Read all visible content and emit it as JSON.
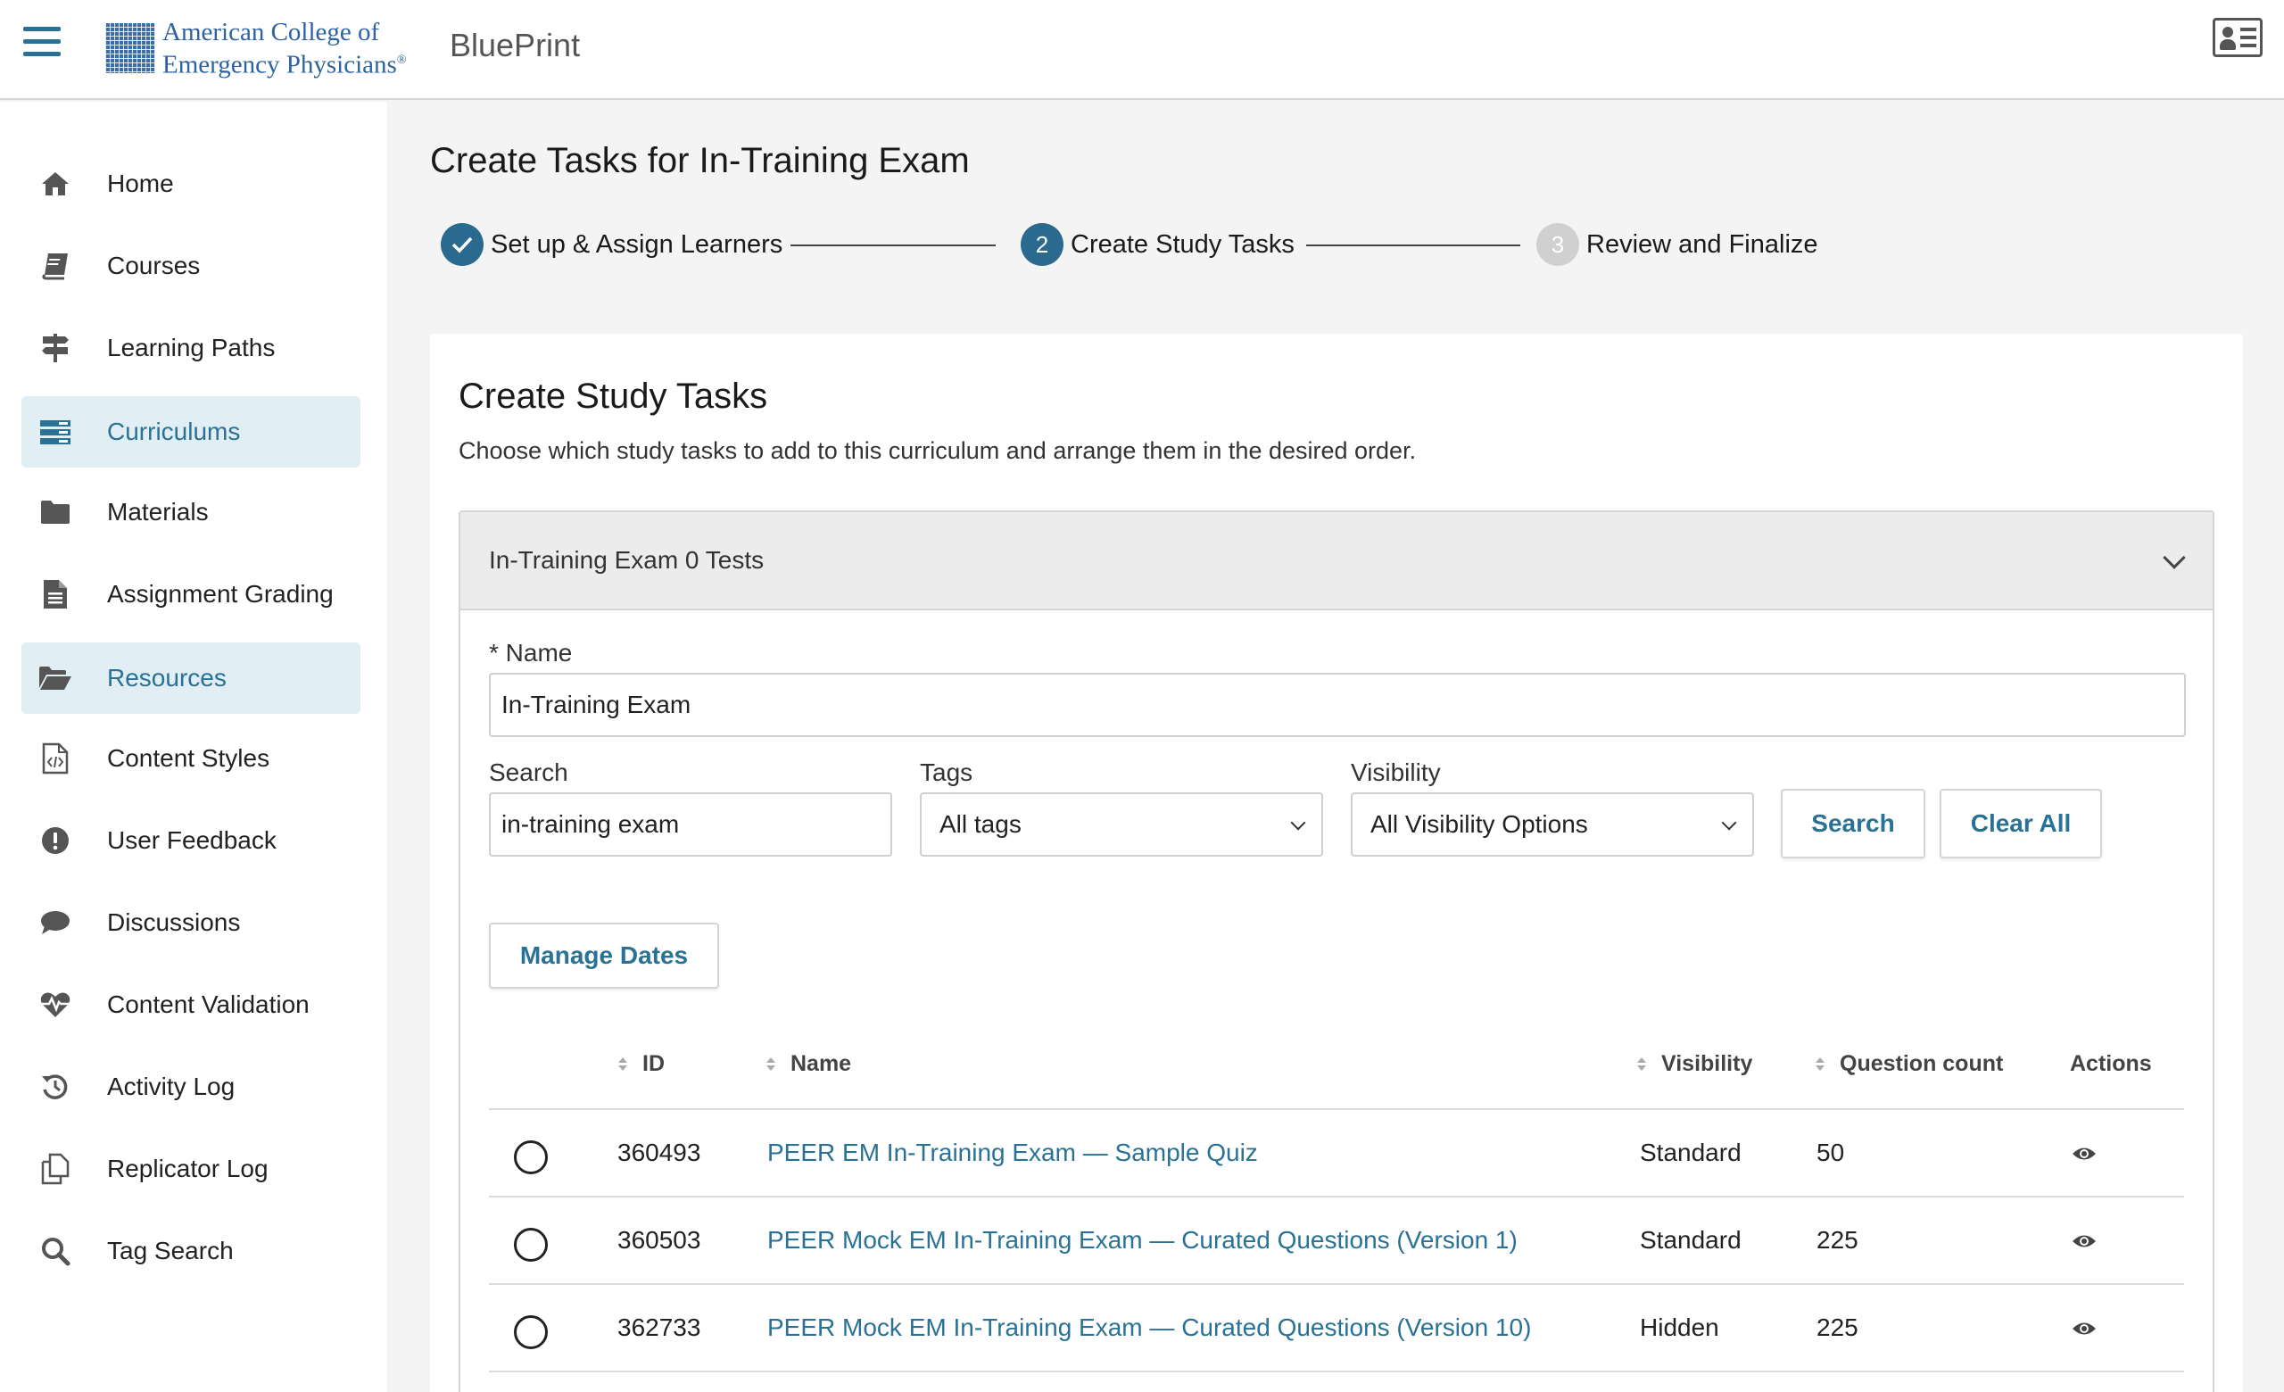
{
  "header": {
    "logo_line1": "American College of",
    "logo_line2": "Emergency Physicians",
    "logo_mark": "®",
    "app_name": "BluePrint"
  },
  "sidebar": {
    "items": [
      {
        "label": "Home",
        "icon": "home-icon",
        "active": false
      },
      {
        "label": "Courses",
        "icon": "book-icon",
        "active": false
      },
      {
        "label": "Learning Paths",
        "icon": "signpost-icon",
        "active": false
      },
      {
        "label": "Curriculums",
        "icon": "list-icon",
        "active": true
      },
      {
        "label": "Materials",
        "icon": "folder-icon",
        "active": false
      },
      {
        "label": "Assignment Grading",
        "icon": "document-icon",
        "active": false
      },
      {
        "label": "Resources",
        "icon": "folder-open-icon",
        "active": true
      },
      {
        "label": "Content Styles",
        "icon": "code-file-icon",
        "active": false
      },
      {
        "label": "User Feedback",
        "icon": "exclamation-icon",
        "active": false
      },
      {
        "label": "Discussions",
        "icon": "chat-icon",
        "active": false
      },
      {
        "label": "Content Validation",
        "icon": "heartbeat-icon",
        "active": false
      },
      {
        "label": "Activity Log",
        "icon": "history-icon",
        "active": false
      },
      {
        "label": "Replicator Log",
        "icon": "copy-icon",
        "active": false
      },
      {
        "label": "Tag Search",
        "icon": "search-icon",
        "active": false
      }
    ]
  },
  "page": {
    "title": "Create Tasks for In-Training Exam"
  },
  "stepper": {
    "steps": [
      {
        "number": "",
        "label": "Set up & Assign Learners",
        "state": "complete"
      },
      {
        "number": "2",
        "label": "Create Study Tasks",
        "state": "current"
      },
      {
        "number": "3",
        "label": "Review and Finalize",
        "state": "upcoming"
      }
    ]
  },
  "card": {
    "title": "Create Study Tasks",
    "subtitle": "Choose which study tasks to add to this curriculum and arrange them in the desired order."
  },
  "panel": {
    "header": "In-Training Exam 0 Tests",
    "name_label": "* Name",
    "name_value": "In-Training Exam",
    "search_label": "Search",
    "search_value": "in-training exam",
    "tags_label": "Tags",
    "tags_value": "All tags",
    "visibility_label": "Visibility",
    "visibility_value": "All Visibility Options",
    "search_button": "Search",
    "clear_button": "Clear All",
    "manage_dates_button": "Manage Dates"
  },
  "table": {
    "headers": {
      "id": "ID",
      "name": "Name",
      "visibility": "Visibility",
      "question_count": "Question count",
      "actions": "Actions"
    },
    "rows": [
      {
        "id": "360493",
        "name": "PEER EM In-Training Exam — Sample Quiz",
        "visibility": "Standard",
        "question_count": "50"
      },
      {
        "id": "360503",
        "name": "PEER Mock EM In-Training Exam — Curated Questions (Version 1)",
        "visibility": "Standard",
        "question_count": "225"
      },
      {
        "id": "362733",
        "name": "PEER Mock EM In-Training Exam — Curated Questions (Version 10)",
        "visibility": "Hidden",
        "question_count": "225"
      }
    ]
  },
  "colors": {
    "accent": "#2a7295",
    "active_bg": "#e1eef3",
    "step_complete": "#2a6a8f",
    "step_upcoming": "#d0d0d0"
  }
}
